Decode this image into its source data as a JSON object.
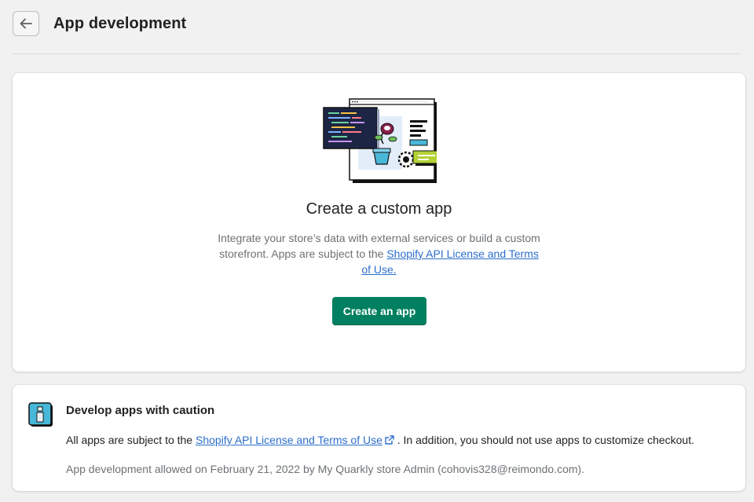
{
  "header": {
    "title": "App development"
  },
  "main_card": {
    "title": "Create a custom app",
    "desc_text": "Integrate your store’s data with external services or build a custom storefront. Apps are subject to the ",
    "desc_link": "Shopify API License and Terms of Use.",
    "button_label": "Create an app"
  },
  "caution_card": {
    "title": "Develop apps with caution",
    "text_before": "All apps are subject to the ",
    "link": "Shopify API License and Terms of Use",
    "text_after": " . In addition, you should not use apps to customize checkout.",
    "meta": "App development allowed on February 21, 2022 by My Quarkly store Admin (cohovis328@reimondo.com)."
  },
  "colors": {
    "primary": "#008060",
    "link": "#2c6ecb",
    "background": "#f1f1f1"
  },
  "icons": {
    "back": "arrow-left-icon",
    "info": "info-icon",
    "external": "external-link-icon"
  }
}
